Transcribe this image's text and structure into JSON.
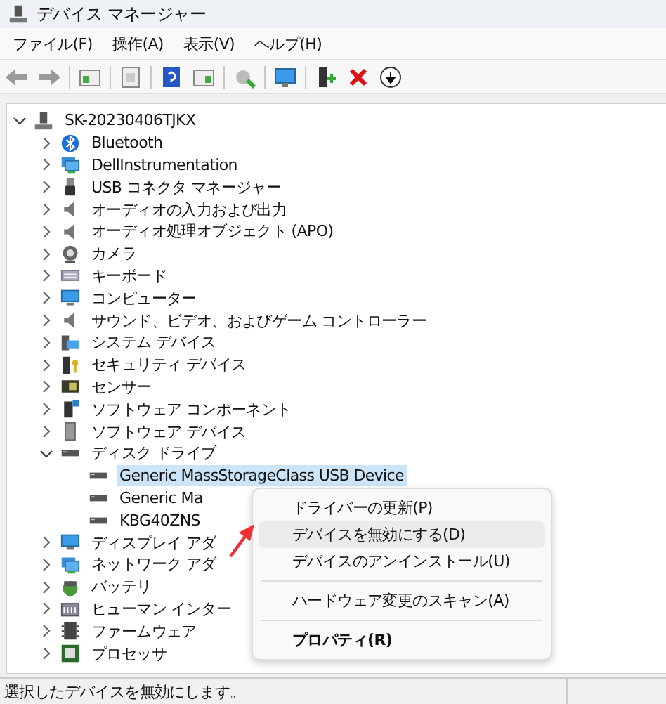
{
  "window": {
    "title": "デバイス マネージャー"
  },
  "menu": [
    "ファイル(F)",
    "操作(A)",
    "表示(V)",
    "ヘルプ(H)"
  ],
  "tree": {
    "label": "SK-20230406TJKX",
    "expanded": true,
    "selected": false,
    "children": [
      {
        "label": "Bluetooth",
        "expanded": false,
        "selected": false
      },
      {
        "label": "DellInstrumentation",
        "expanded": false,
        "selected": false
      },
      {
        "label": "USB コネクタ マネージャー",
        "expanded": false,
        "selected": false
      },
      {
        "label": "オーディオの入力および出力",
        "expanded": false,
        "selected": false
      },
      {
        "label": "オーディオ処理オブジェクト (APO)",
        "expanded": false,
        "selected": false
      },
      {
        "label": "カメラ",
        "expanded": false,
        "selected": false
      },
      {
        "label": "キーボード",
        "expanded": false,
        "selected": false
      },
      {
        "label": "コンピューター",
        "expanded": false,
        "selected": false
      },
      {
        "label": "サウンド、ビデオ、およびゲーム コントローラー",
        "expanded": false,
        "selected": false
      },
      {
        "label": "システム デバイス",
        "expanded": false,
        "selected": false
      },
      {
        "label": "セキュリティ デバイス",
        "expanded": false,
        "selected": false
      },
      {
        "label": "センサー",
        "expanded": false,
        "selected": false
      },
      {
        "label": "ソフトウェア コンポーネント",
        "expanded": false,
        "selected": false
      },
      {
        "label": "ソフトウェア デバイス",
        "expanded": false,
        "selected": false
      },
      {
        "label": "ディスク ドライブ",
        "expanded": true,
        "selected": false,
        "children": [
          {
            "label": "Generic MassStorageClass USB Device",
            "selected": true
          },
          {
            "label": "Generic Ma",
            "selected": false
          },
          {
            "label": "KBG40ZNS",
            "selected": false
          }
        ]
      },
      {
        "label": "ディスプレイ アダ",
        "expanded": false,
        "selected": false
      },
      {
        "label": "ネットワーク アダ",
        "expanded": false,
        "selected": false
      },
      {
        "label": "バッテリ",
        "expanded": false,
        "selected": false
      },
      {
        "label": "ヒューマン インター",
        "expanded": false,
        "selected": false
      },
      {
        "label": "ファームウェア",
        "expanded": false,
        "selected": false
      },
      {
        "label": "プロセッサ",
        "expanded": false,
        "selected": false
      }
    ]
  },
  "context_menu": {
    "items": [
      {
        "kind": "item",
        "label": "ドライバーの更新(P)",
        "selected": false,
        "default": false
      },
      {
        "kind": "item",
        "label": "デバイスを無効にする(D)",
        "selected": true,
        "default": false
      },
      {
        "kind": "item",
        "label": "デバイスのアンインストール(U)",
        "selected": false,
        "default": false
      },
      {
        "kind": "separator"
      },
      {
        "kind": "item",
        "label": "ハードウェア変更のスキャン(A)",
        "selected": false,
        "default": false
      },
      {
        "kind": "separator"
      },
      {
        "kind": "item",
        "label": "プロパティ(R)",
        "selected": false,
        "default": true
      }
    ]
  },
  "status_bar": {
    "text": "選択したデバイスを無効にします。"
  }
}
